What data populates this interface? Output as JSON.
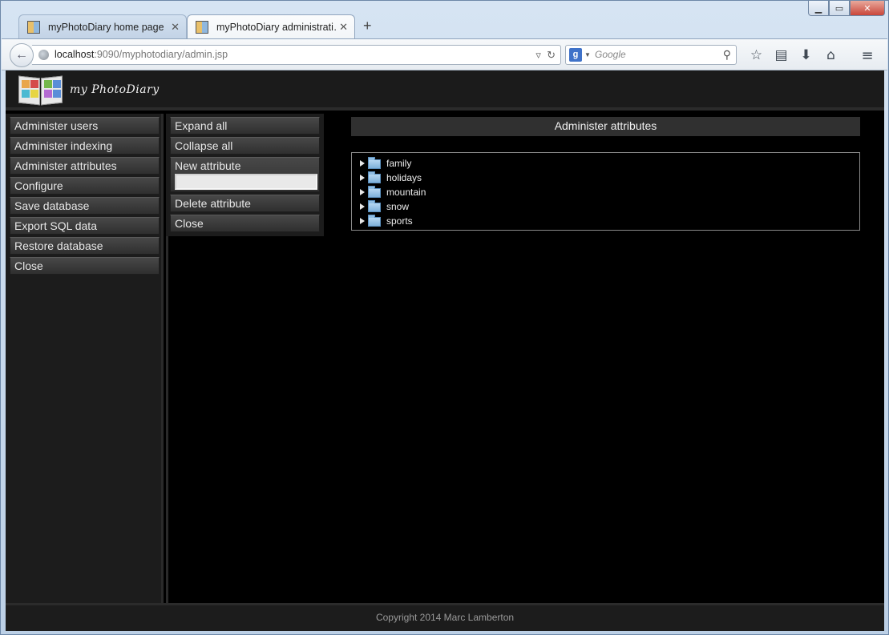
{
  "browser": {
    "tabs": [
      {
        "label": "myPhotoDiary home page",
        "active": false
      },
      {
        "label": "myPhotoDiary administrati…",
        "active": true
      }
    ],
    "new_tab": "+",
    "url_host": "localhost",
    "url_rest": ":9090/myphotodiary/admin.jsp",
    "search_placeholder": "Google",
    "search_engine_letter": "g",
    "window_buttons": {
      "minimize": "▁",
      "maximize": "▭",
      "close": "✕"
    },
    "icons": [
      "back-arrow-icon",
      "globe-icon",
      "reload-icon",
      "search-icon",
      "star-icon",
      "reading-list-icon",
      "download-icon",
      "home-icon",
      "menu-icon"
    ]
  },
  "site": {
    "name": "my PhotoDiary"
  },
  "sidebar": {
    "items": [
      {
        "label": "Administer users"
      },
      {
        "label": "Administer indexing"
      },
      {
        "label": "Administer attributes"
      },
      {
        "label": "Configure"
      },
      {
        "label": "Save database"
      },
      {
        "label": "Export SQL data"
      },
      {
        "label": "Restore database"
      },
      {
        "label": "Close"
      }
    ]
  },
  "submenu": {
    "expand_all": "Expand all",
    "collapse_all": "Collapse all",
    "new_attribute": "New attribute",
    "new_attribute_value": "",
    "delete_attribute": "Delete attribute",
    "close": "Close"
  },
  "main": {
    "title": "Administer attributes",
    "tree": [
      {
        "label": "family"
      },
      {
        "label": "holidays"
      },
      {
        "label": "mountain"
      },
      {
        "label": "snow"
      },
      {
        "label": "sports"
      }
    ]
  },
  "footer": {
    "copyright": "Copyright 2014 Marc Lamberton"
  },
  "colors": {
    "page_bg": "#000000",
    "panel_bg": "#1c1c1c",
    "button_bg": "#3c3c3c",
    "folder_blue": "#7fb1da"
  }
}
